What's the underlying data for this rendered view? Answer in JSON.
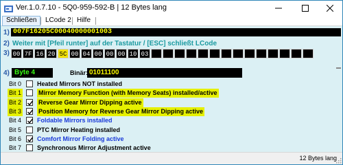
{
  "window": {
    "title": "Ver.1.0.7.10 -   5Q0-959-592-B | 12 Bytes lang",
    "controls": {
      "minimize": "minimize",
      "maximize": "maximize",
      "close": "close"
    }
  },
  "menu": {
    "items": [
      {
        "label": "Schließen"
      },
      {
        "label": "LCode 2"
      },
      {
        "label": "Hilfe"
      }
    ]
  },
  "row1": {
    "num": "1)",
    "value": "007F16205C00040000001003"
  },
  "row2": {
    "num": "2)",
    "text": "Weiter mit [Pfeil runter] auf der Tastatur / [ESC] schließt LCode"
  },
  "row3": {
    "num": "3)",
    "bytes": [
      "00",
      "7F",
      "16",
      "20",
      "5C",
      "00",
      "04",
      "00",
      "00",
      "00",
      "10",
      "03",
      "",
      "",
      "",
      "",
      "",
      "",
      "",
      "",
      "",
      "",
      "",
      "",
      "",
      ""
    ],
    "highlight_index": 4
  },
  "row4": {
    "num": "4)",
    "byte_label": "Byte 4",
    "bin_label": "Binär:",
    "bin_value": "01011100"
  },
  "bits": [
    {
      "label": "Bit 0",
      "checked": false,
      "highlight": false,
      "color": "black",
      "desc": "Heated Mirrors NOT installed"
    },
    {
      "label": "Bit 1",
      "checked": false,
      "highlight": true,
      "color": "black",
      "desc": "Mirror Memory Function (with Memory Seats) installed/active"
    },
    {
      "label": "Bit 2",
      "checked": true,
      "highlight": true,
      "color": "black",
      "desc": "Reverse Gear Mirror Dipping active"
    },
    {
      "label": "Bit 3",
      "checked": true,
      "highlight": true,
      "color": "black",
      "desc": "Position Memory for Reverse Gear Mirror Dipping active"
    },
    {
      "label": "Bit 4",
      "checked": true,
      "highlight": false,
      "color": "blue",
      "desc": "Foldable Mirrors installed"
    },
    {
      "label": "Bit 5",
      "checked": false,
      "highlight": false,
      "color": "black",
      "desc": "PTC Mirror Heating installed"
    },
    {
      "label": "Bit 6",
      "checked": true,
      "highlight": false,
      "color": "blue",
      "desc": "Comfort Mirror Folding active"
    },
    {
      "label": "Bit 7",
      "checked": false,
      "highlight": false,
      "color": "black",
      "desc": "Synchronous Mirror Adjustment active"
    }
  ],
  "status": {
    "text": "12 Bytes lang"
  },
  "colors": {
    "accent": "#2f86b8",
    "body_bg": "#dbf0f4",
    "highlight": "#e6f000",
    "label_blue": "#1a3ad8",
    "hint_teal": "#1a9aa0"
  }
}
